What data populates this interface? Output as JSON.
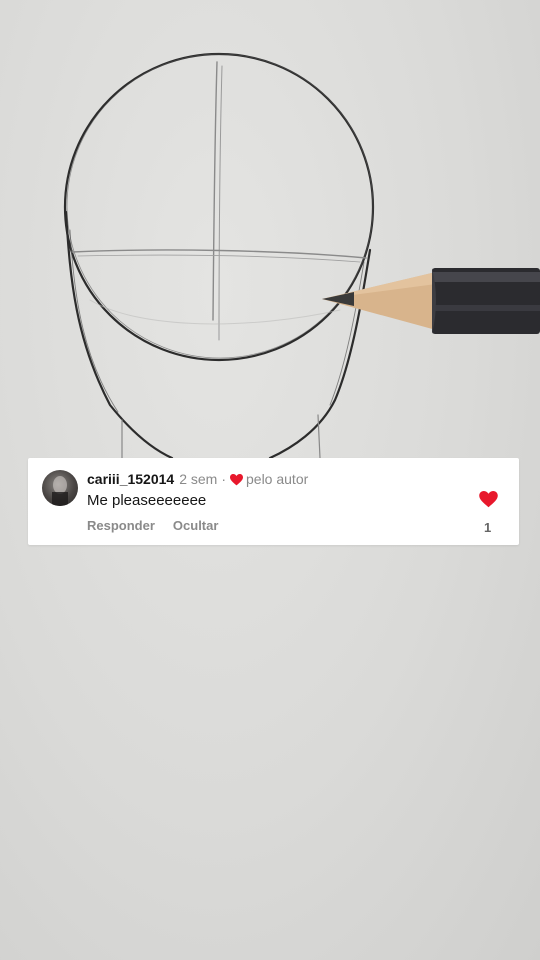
{
  "comment": {
    "username": "cariii_152014",
    "time": "2 sem",
    "separator": "·",
    "liked_by_label": "pelo autor",
    "text": "Me pleaseeeeeee",
    "reply_label": "Responder",
    "hide_label": "Ocultar",
    "like_count": "1"
  },
  "icons": {
    "small_heart": "heart-icon",
    "like_heart": "heart-icon",
    "pencil": "pencil"
  },
  "colors": {
    "heart": "#e8182c",
    "card_bg": "#ffffff",
    "muted_text": "#8a8a8a"
  }
}
